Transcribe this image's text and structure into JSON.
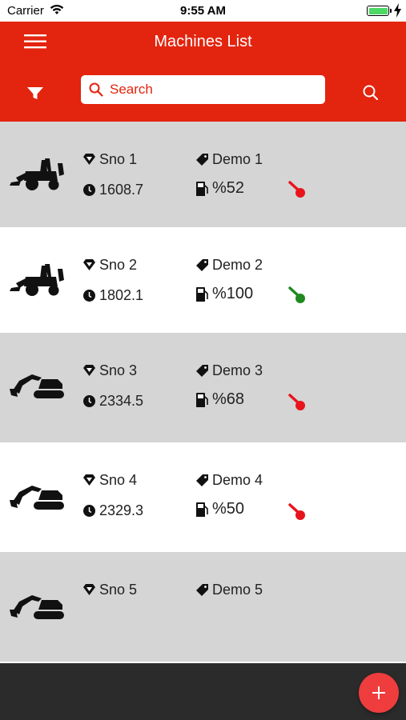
{
  "status_bar": {
    "carrier": "Carrier",
    "time": "9:55 AM"
  },
  "nav": {
    "title": "Machines List",
    "menu_icon": "hamburger-icon"
  },
  "search": {
    "placeholder": "Search",
    "filter_icon": "filter-icon",
    "search_icon": "search-icon"
  },
  "colors": {
    "brand": "#e3240e",
    "alt_row": "#d5d5d5",
    "footer": "#2b2b2b",
    "fab": "#ef3d3d",
    "key_off": "#e8141c",
    "key_on": "#1f8a1f"
  },
  "machines": [
    {
      "sno": "Sno 1",
      "name": "Demo 1",
      "hours": "1608.7",
      "fuel": "%52",
      "machine_type": "backhoe-loader-icon",
      "key_status": "red"
    },
    {
      "sno": "Sno 2",
      "name": "Demo 2",
      "hours": "1802.1",
      "fuel": "%100",
      "machine_type": "backhoe-loader-icon",
      "key_status": "green"
    },
    {
      "sno": "Sno 3",
      "name": "Demo 3",
      "hours": "2334.5",
      "fuel": "%68",
      "machine_type": "excavator-icon",
      "key_status": "red"
    },
    {
      "sno": "Sno 4",
      "name": "Demo 4",
      "hours": "2329.3",
      "fuel": "%50",
      "machine_type": "excavator-icon",
      "key_status": "red"
    },
    {
      "sno": "Sno 5",
      "name": "Demo 5",
      "machine_type": "excavator-icon"
    }
  ],
  "fab": {
    "icon": "plus-icon"
  }
}
